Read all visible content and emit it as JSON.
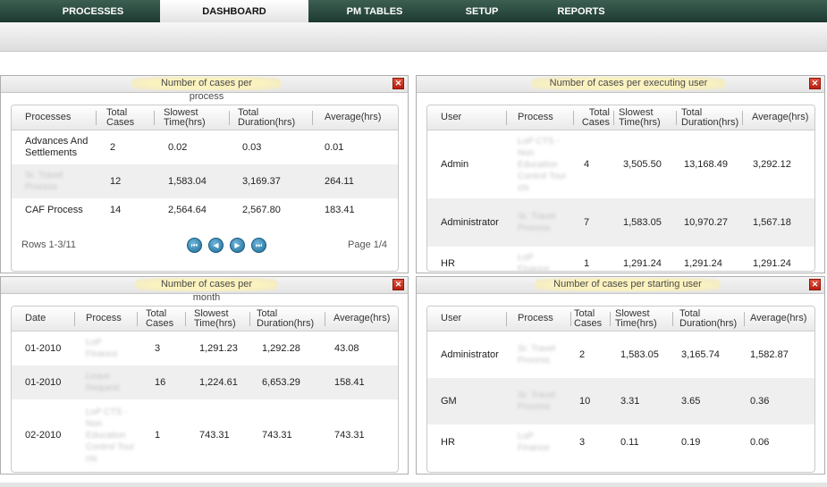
{
  "nav": {
    "tabs": [
      {
        "label": "PROCESSES"
      },
      {
        "label": "DASHBOARD",
        "active": true
      },
      {
        "label": "PM TABLES"
      },
      {
        "label": "SETUP"
      },
      {
        "label": "REPORTS"
      }
    ]
  },
  "panels": {
    "per_process": {
      "title": "Number of cases per process",
      "headers": [
        "Processes",
        "Total Cases",
        "Slowest Time(hrs)",
        "Total Duration(hrs)",
        "Average(hrs)"
      ],
      "rows": [
        {
          "process": "Advances And Settlements",
          "total": "2",
          "slowest": "0.02",
          "duration": "0.03",
          "average": "0.01"
        },
        {
          "process": "Sr. Travel Process",
          "total": "12",
          "slowest": "1,583.04",
          "duration": "3,169.37",
          "average": "264.11"
        },
        {
          "process": "CAF Process",
          "total": "14",
          "slowest": "2,564.64",
          "duration": "2,567.80",
          "average": "183.41"
        }
      ],
      "rows_info": "Rows 1-3/11",
      "page_info": "Page 1/4"
    },
    "per_exec_user": {
      "title": "Number of cases per executing user",
      "headers": [
        "User",
        "Process",
        "Total Cases",
        "Slowest Time(hrs)",
        "Total Duration(hrs)",
        "Average(hrs)"
      ],
      "rows": [
        {
          "user": "Admin",
          "process": "LoP CTS - Non Education Control Tour cts",
          "total": "4",
          "slowest": "3,505.50",
          "duration": "13,168.49",
          "average": "3,292.12"
        },
        {
          "user": "Administrator",
          "process": "Sr. Travel Process",
          "total": "7",
          "slowest": "1,583.05",
          "duration": "10,970.27",
          "average": "1,567.18"
        },
        {
          "user": "HR",
          "process": "LoP Finance",
          "total": "1",
          "slowest": "1,291.24",
          "duration": "1,291.24",
          "average": "1,291.24"
        }
      ]
    },
    "per_month": {
      "title": "Number of cases per month",
      "headers": [
        "Date",
        "Process",
        "Total Cases",
        "Slowest Time(hrs)",
        "Total Duration(hrs)",
        "Average(hrs)"
      ],
      "rows": [
        {
          "date": "01-2010",
          "process": "LoP Finance",
          "total": "3",
          "slowest": "1,291.23",
          "duration": "1,292.28",
          "average": "43.08"
        },
        {
          "date": "01-2010",
          "process": "Leave Request",
          "total": "16",
          "slowest": "1,224.61",
          "duration": "6,653.29",
          "average": "158.41"
        },
        {
          "date": "02-2010",
          "process": "LoP CTS - Non Education Control Tour cts",
          "total": "1",
          "slowest": "743.31",
          "duration": "743.31",
          "average": "743.31"
        }
      ]
    },
    "per_start_user": {
      "title": "Number of cases per starting user",
      "headers": [
        "User",
        "Process",
        "Total Cases",
        "Slowest Time(hrs)",
        "Total Duration(hrs)",
        "Average(hrs)"
      ],
      "rows": [
        {
          "user": "Administrator",
          "process": "Sr. Travel Process",
          "total": "2",
          "slowest": "1,583.05",
          "duration": "3,165.74",
          "average": "1,582.87"
        },
        {
          "user": "GM",
          "process": "Sr. Travel Process",
          "total": "10",
          "slowest": "3.31",
          "duration": "3.65",
          "average": "0.36"
        },
        {
          "user": "HR",
          "process": "LoP Finance",
          "total": "3",
          "slowest": "0.11",
          "duration": "0.19",
          "average": "0.06"
        }
      ]
    }
  },
  "icons": {
    "close": "close-icon",
    "first": "first-page-icon",
    "prev": "previous-page-icon",
    "next": "next-page-icon",
    "last": "last-page-icon"
  },
  "colors": {
    "nav_bg": "#2b4a3f",
    "caption_highlight": "#fbf2bf",
    "close_red": "#c8301f",
    "pager_blue": "#2a7fae"
  }
}
